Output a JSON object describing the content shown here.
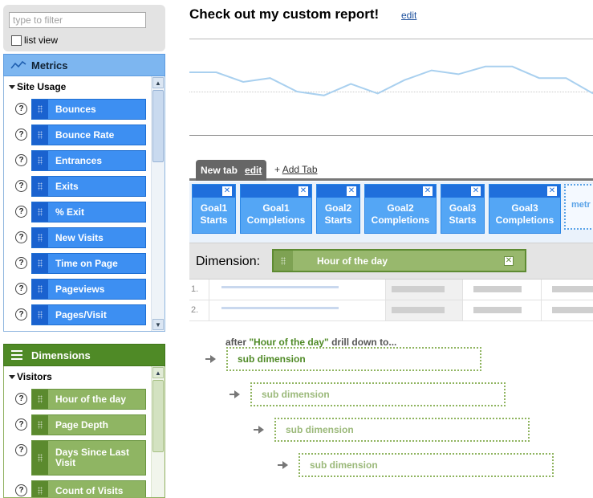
{
  "filter": {
    "placeholder": "type to filter",
    "list_view_label": "list view"
  },
  "metrics": {
    "header": "Metrics",
    "group": "Site Usage",
    "items": [
      {
        "label": "Bounces"
      },
      {
        "label": "Bounce Rate"
      },
      {
        "label": "Entrances"
      },
      {
        "label": "Exits"
      },
      {
        "label": "% Exit"
      },
      {
        "label": "New Visits"
      },
      {
        "label": "Time on Page"
      },
      {
        "label": "Pageviews"
      },
      {
        "label": "Pages/Visit"
      }
    ]
  },
  "dimensions": {
    "header": "Dimensions",
    "group": "Visitors",
    "items": [
      {
        "label": "Hour of the day"
      },
      {
        "label": "Page Depth"
      },
      {
        "label": "Days Since Last Visit"
      },
      {
        "label": "Count of Visits"
      }
    ]
  },
  "report": {
    "title": "Check out my custom report!",
    "edit_label": "edit"
  },
  "trend": {
    "values": [
      0.5,
      0.5,
      0.25,
      0.35,
      0.0,
      -0.1,
      0.2,
      -0.05,
      0.3,
      0.55,
      0.45,
      0.65,
      0.65,
      0.35,
      0.35,
      -0.05
    ]
  },
  "tabs": {
    "active_label": "New tab",
    "active_edit": "edit",
    "add_plus": "+",
    "add_label": "Add Tab"
  },
  "report_metrics": [
    {
      "line1": "Goal1",
      "line2": "Starts"
    },
    {
      "line1": "Goal1",
      "line2": "Completions"
    },
    {
      "line1": "Goal2",
      "line2": "Starts"
    },
    {
      "line1": "Goal2",
      "line2": "Completions"
    },
    {
      "line1": "Goal3",
      "line2": "Starts"
    },
    {
      "line1": "Goal3",
      "line2": "Completions"
    }
  ],
  "metric_drop_label": "metr",
  "dimension_row": {
    "label": "Dimension:",
    "value": "Hour of the day"
  },
  "table_rows": [
    {
      "num": "1."
    },
    {
      "num": "2."
    }
  ],
  "drilldown": {
    "prefix": "after ",
    "quoted": "\"Hour of the day\"",
    "suffix": " drill down to...",
    "sub_label": "sub dimension"
  },
  "close_glyph": "✕",
  "help_glyph": "?"
}
